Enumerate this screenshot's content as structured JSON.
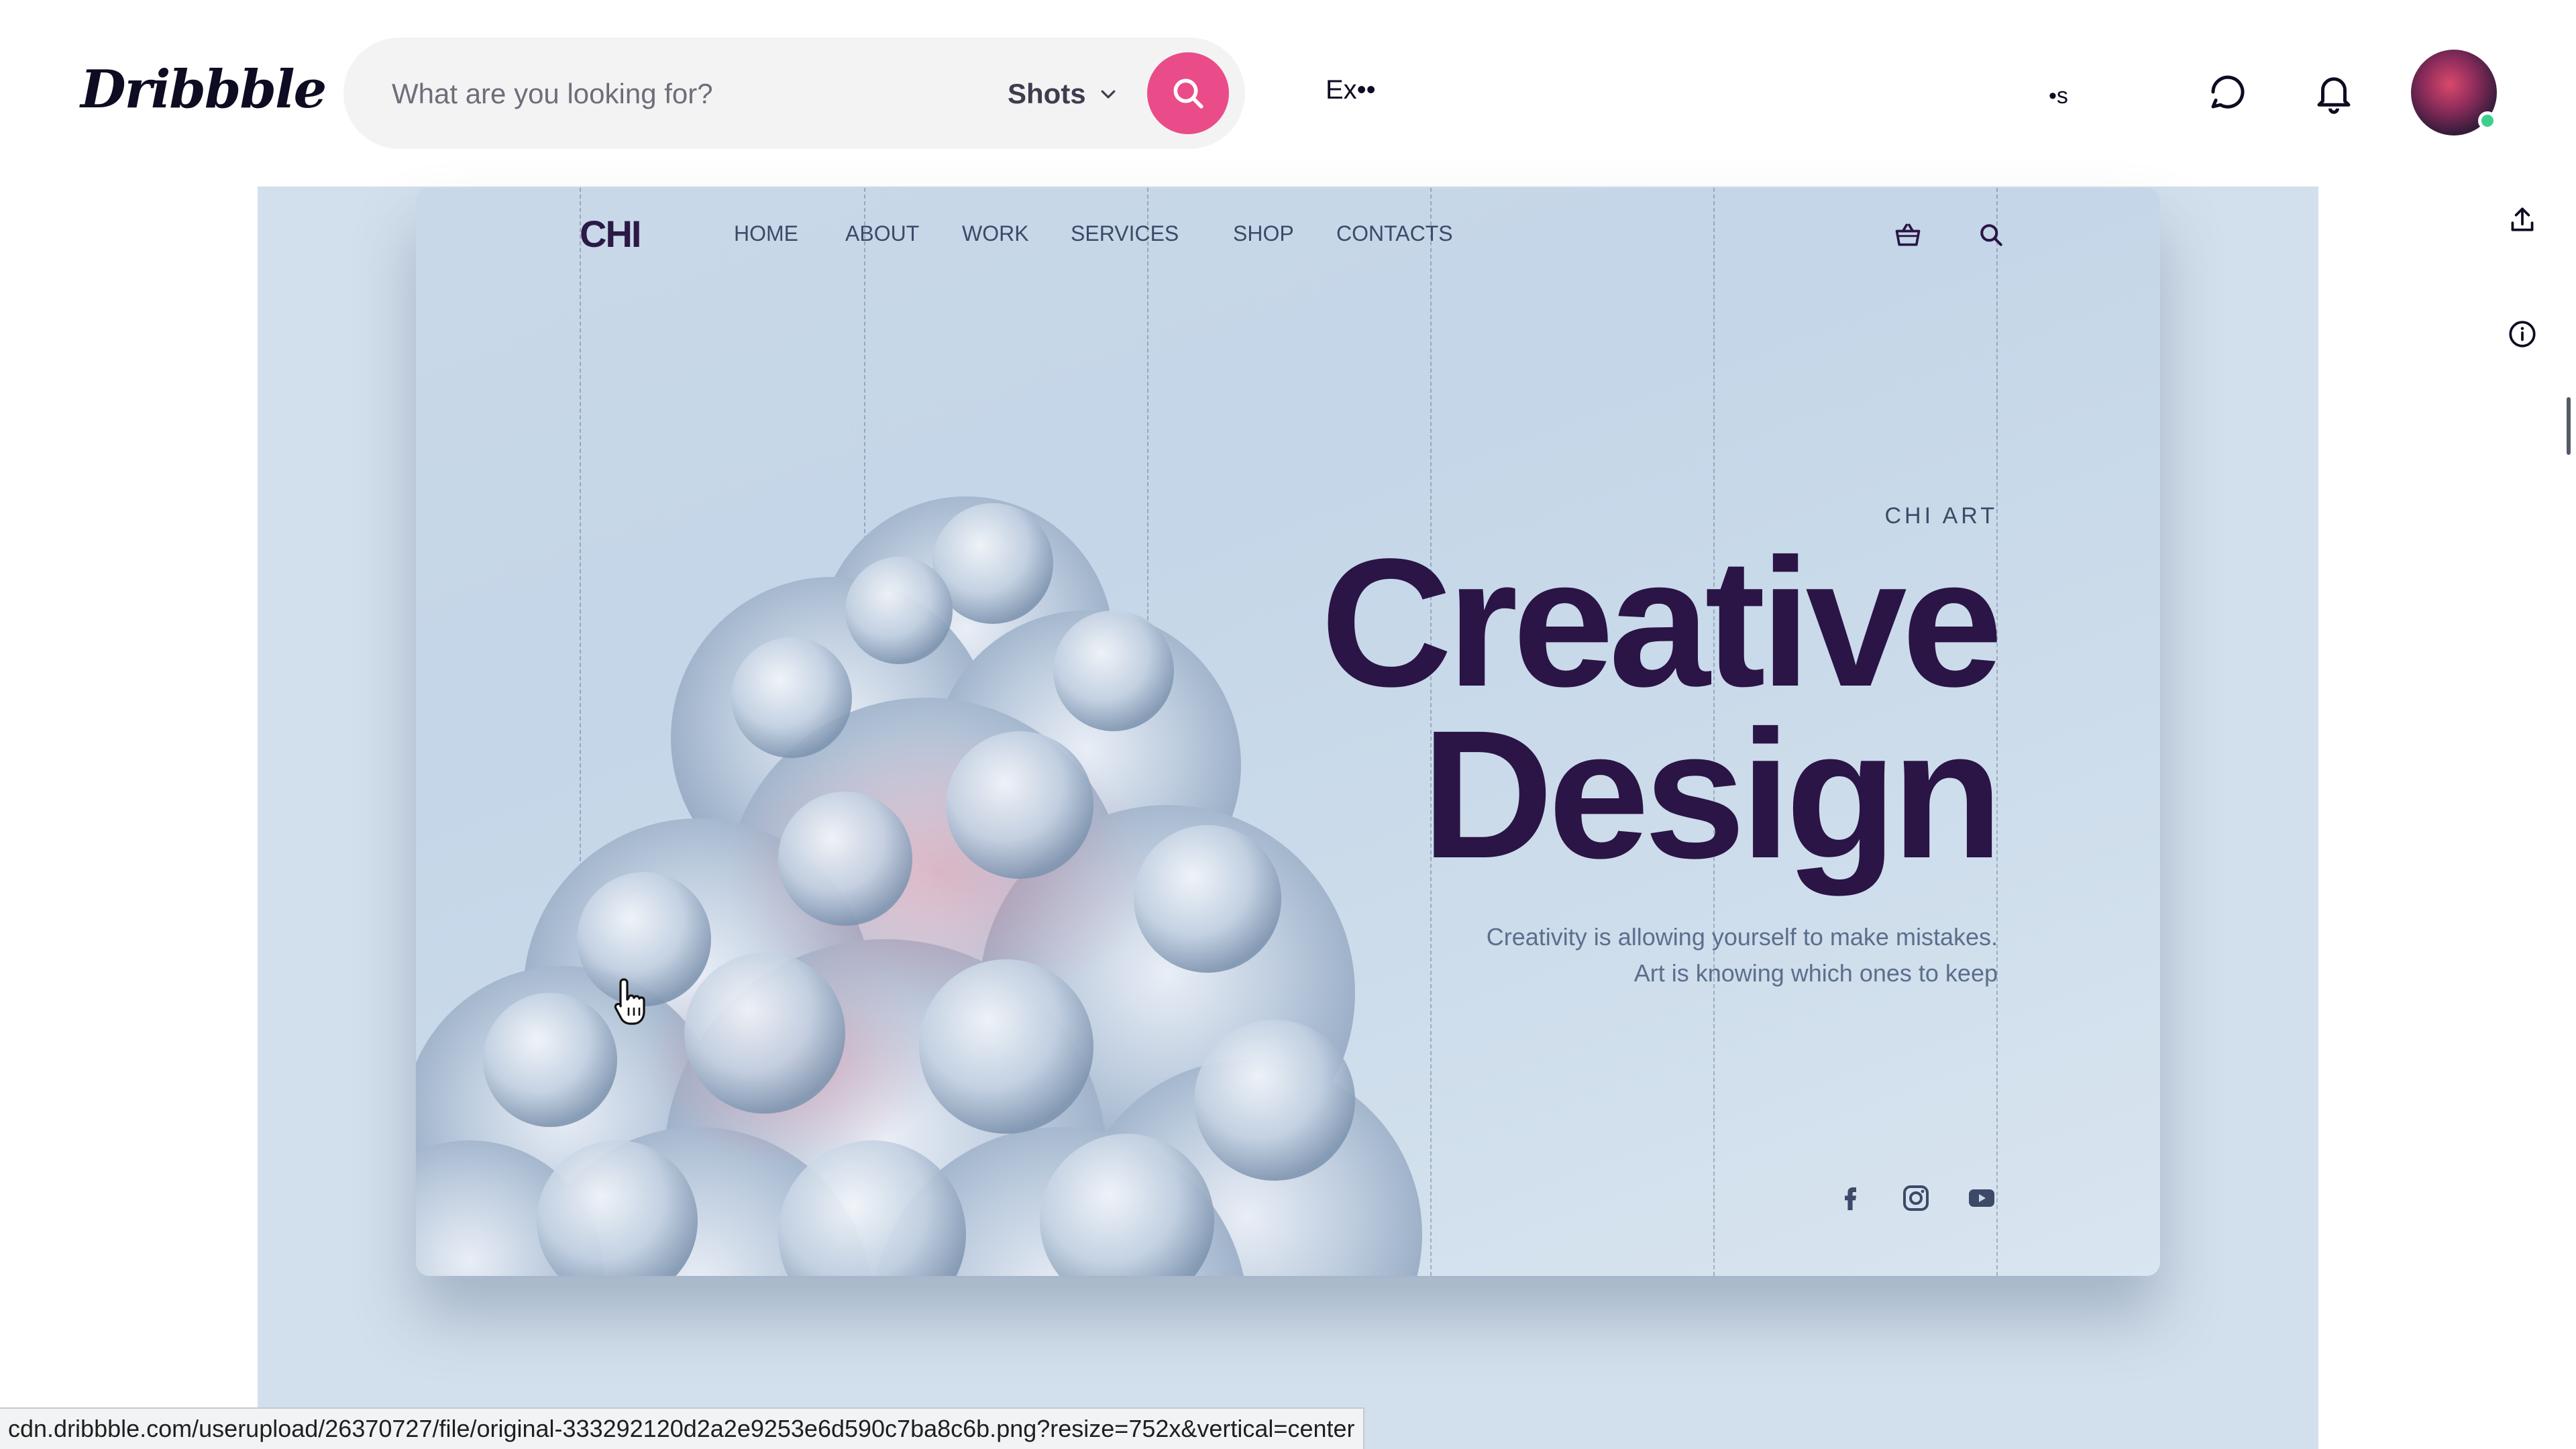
{
  "app": {
    "logo": "Dribbble"
  },
  "search": {
    "placeholder": "What are you looking for?",
    "type_selected": "Shots",
    "button_color": "#ea4c89"
  },
  "header": {
    "nav_fragment_1": "Ex••",
    "nav_fragment_2": "•s",
    "icons": [
      "message-icon",
      "bell-icon"
    ],
    "avatar_status": "online"
  },
  "shot": {
    "logo": "CHI",
    "nav": [
      "HOME",
      "ABOUT",
      "WORK",
      "SERVICES",
      "SHOP",
      "CONTACTS"
    ],
    "icons": [
      "basket-icon",
      "search-icon"
    ],
    "eyebrow": "CHI ART",
    "headline_line1": "Creative",
    "headline_line2": "Design",
    "tagline_line1": "Creativity is allowing yourself to make mistakes.",
    "tagline_line2": "Art is knowing which ones to keep",
    "social": [
      "facebook-icon",
      "instagram-icon",
      "youtube-icon"
    ],
    "colors": {
      "headline": "#2b1446",
      "background": "#c9d8e8"
    }
  },
  "rail": {
    "icons": [
      "share-icon",
      "info-icon"
    ]
  },
  "statusbar": {
    "url": "cdn.dribbble.com/userupload/26370727/file/original-333292120d2a2e9253e6d590c7ba8c6b.png?resize=752x&vertical=center"
  }
}
